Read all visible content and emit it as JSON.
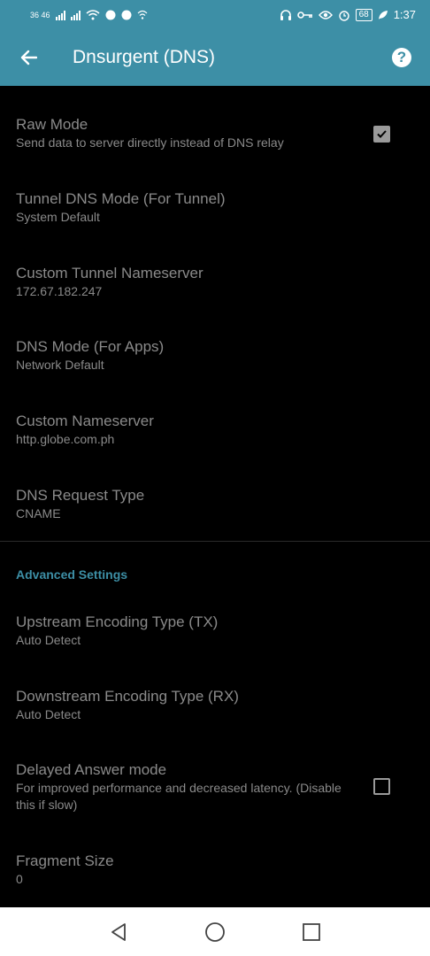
{
  "status_bar": {
    "network_left": "36 46",
    "battery": "68",
    "time": "1:37"
  },
  "app_bar": {
    "title": "Dnsurgent (DNS)",
    "help_glyph": "?"
  },
  "prefs": [
    {
      "title": "Raw Mode",
      "summary": "Send data to server directly instead of DNS relay",
      "checkbox": true,
      "checked": true
    },
    {
      "title": "Tunnel DNS Mode (For Tunnel)",
      "summary": "System Default"
    },
    {
      "title": "Custom Tunnel Nameserver",
      "summary": "172.67.182.247"
    },
    {
      "title": "DNS Mode (For Apps)",
      "summary": "Network Default"
    },
    {
      "title": "Custom Nameserver",
      "summary": "http.globe.com.ph"
    },
    {
      "title": "DNS Request Type",
      "summary": "CNAME"
    }
  ],
  "advanced": {
    "header": "Advanced Settings",
    "prefs": [
      {
        "title": "Upstream Encoding Type (TX)",
        "summary": "Auto Detect"
      },
      {
        "title": "Downstream Encoding Type (RX)",
        "summary": "Auto Detect"
      },
      {
        "title": "Delayed Answer mode",
        "summary": "For improved performance and decreased latency. (Disable this if slow)",
        "checkbox": true,
        "checked": false
      },
      {
        "title": "Fragment Size",
        "summary": "0"
      }
    ]
  },
  "colors": {
    "primary": "#3d8fa6",
    "background": "#000000",
    "text_disabled": "#8a8a8a"
  },
  "icons": {
    "back": "arrow-left-icon",
    "help": "help-circle-icon",
    "nav": [
      "back-triangle-icon",
      "home-circle-icon",
      "recents-square-icon"
    ]
  }
}
